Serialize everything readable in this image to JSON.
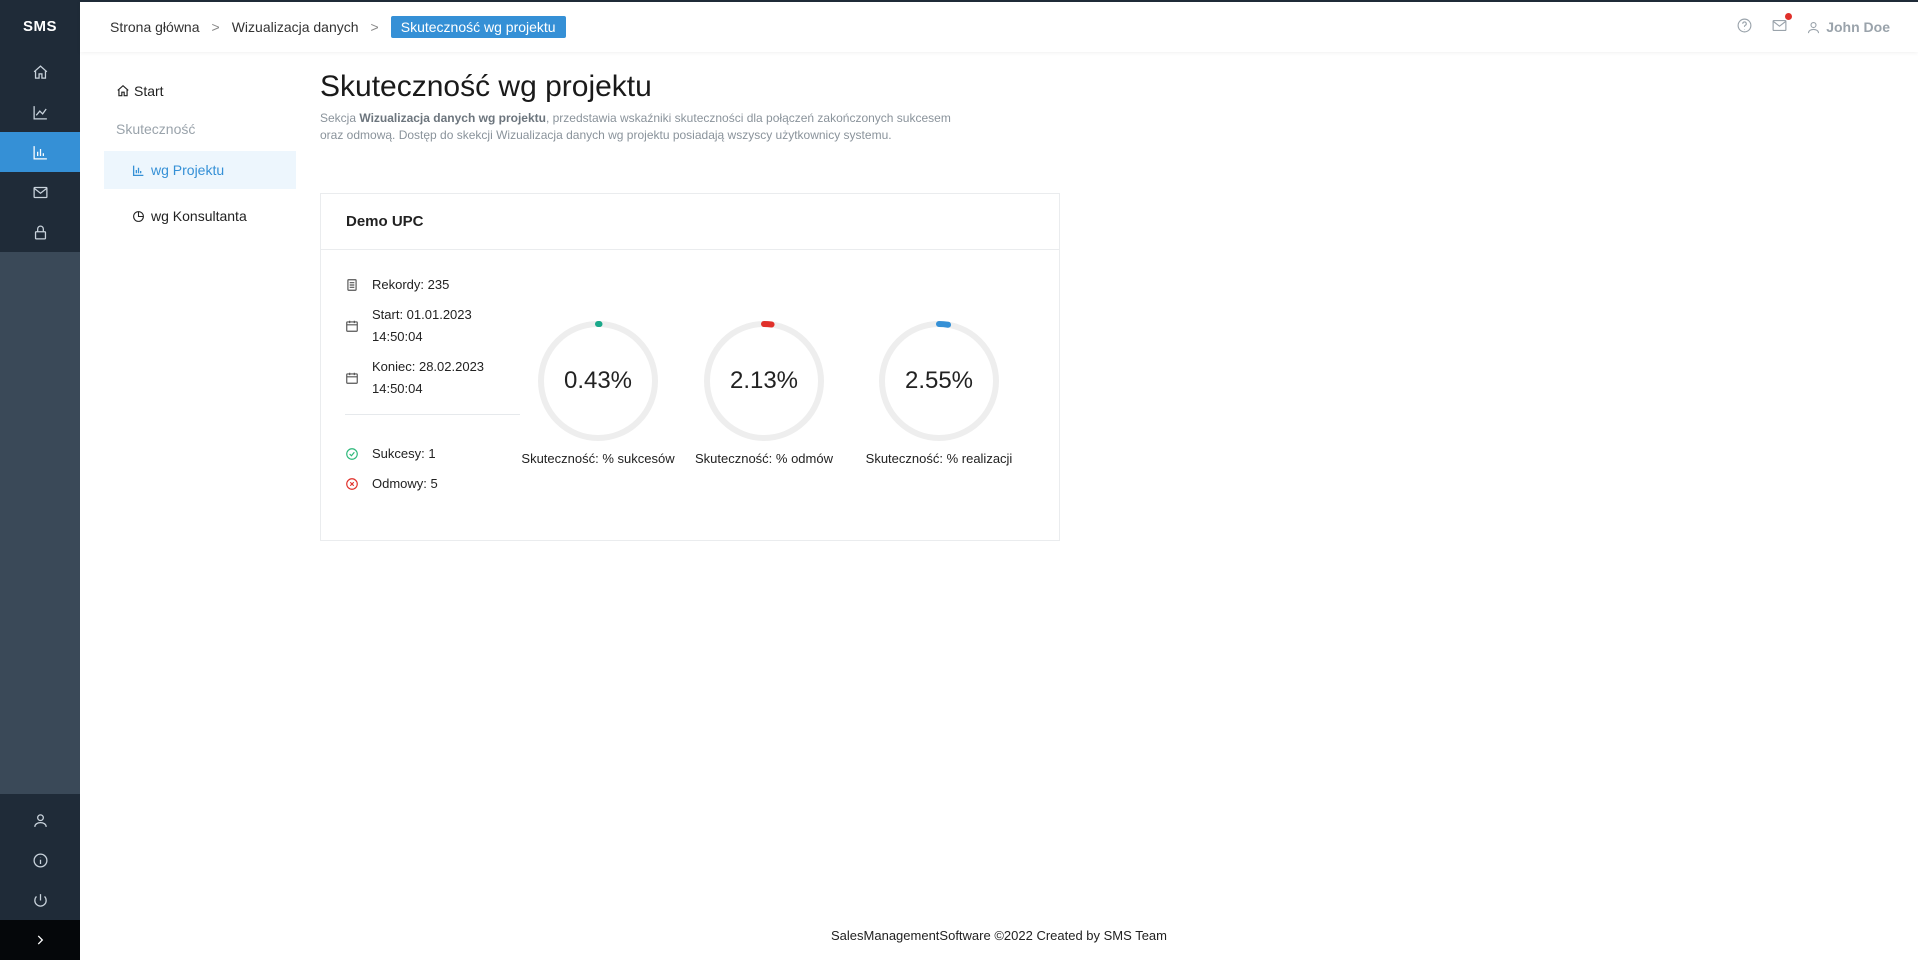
{
  "app": {
    "logo": "SMS"
  },
  "breadcrumb": {
    "items": [
      "Strona główna",
      "Wizualizacja danych"
    ],
    "separator": ">",
    "current": "Skuteczność wg projektu"
  },
  "header": {
    "user_name": "John Doe",
    "has_notification": true
  },
  "subnav": {
    "start_label": "Start",
    "section_label": "Skuteczność",
    "items": [
      {
        "label": "wg Projektu",
        "icon": "bar-chart-icon",
        "active": true
      },
      {
        "label": "wg Konsultanta",
        "icon": "pie-chart-icon",
        "active": false
      }
    ]
  },
  "page": {
    "title": "Skuteczność wg projektu",
    "desc_prefix": "Sekcja ",
    "desc_bold": "Wizualizacja danych wg projektu",
    "desc_rest": ", przedstawia wskaźniki skuteczności dla połączeń zakończonych sukcesem oraz odmową. Dostęp do skekcji Wizualizacja danych wg projektu posiadają wszyscy użytkownicy systemu."
  },
  "project": {
    "name": "Demo UPC",
    "records": "Rekordy: 235",
    "start_line1": "Start: 01.01.2023",
    "start_line2": "14:50:04",
    "end_line1": "Koniec: 28.02.2023",
    "end_line2": "14:50:04",
    "successes": "Sukcesy: 1",
    "refusals": "Odmowy: 5"
  },
  "gauges": [
    {
      "value": 0.43,
      "display": "0.43%",
      "label": "Skuteczność: % sukcesów",
      "color": "#1aa88a"
    },
    {
      "value": 2.13,
      "display": "2.13%",
      "label": "Skuteczność: % odmów",
      "color": "#e0302a"
    },
    {
      "value": 2.55,
      "display": "2.55%",
      "label": "Skuteczność: % realizacji",
      "color": "#3590d6"
    }
  ],
  "colors": {
    "accent": "#3590d6",
    "rail": "#3a4958",
    "rail_dark": "#1f2b38",
    "gauge_track": "#eeeeee"
  },
  "footer": {
    "text": "SalesManagementSoftware ©2022 Created by SMS Team"
  }
}
